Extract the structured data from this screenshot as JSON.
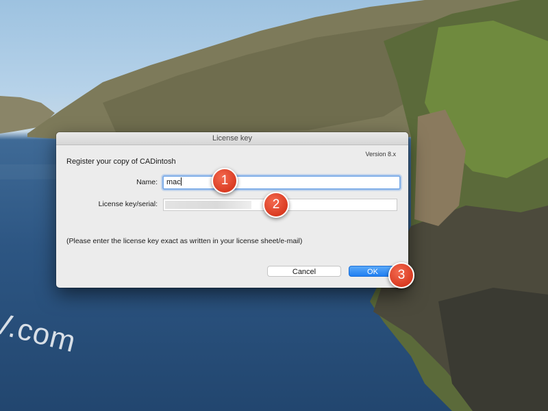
{
  "dialog": {
    "title": "License key",
    "version": "Version 8.x",
    "register_text": "Register your copy of CADintosh",
    "name_label": "Name:",
    "name_value": "mac",
    "serial_label": "License key/serial:",
    "hint": "(Please enter the license key exact as written in your license sheet/e-mail)",
    "cancel_label": "Cancel",
    "ok_label": "OK"
  },
  "callouts": [
    "1",
    "2",
    "3"
  ],
  "watermark": "V.com",
  "colors": {
    "ok_button": "#1f7ef2",
    "callout": "#d93b22",
    "focus_ring": "#7faee8"
  }
}
